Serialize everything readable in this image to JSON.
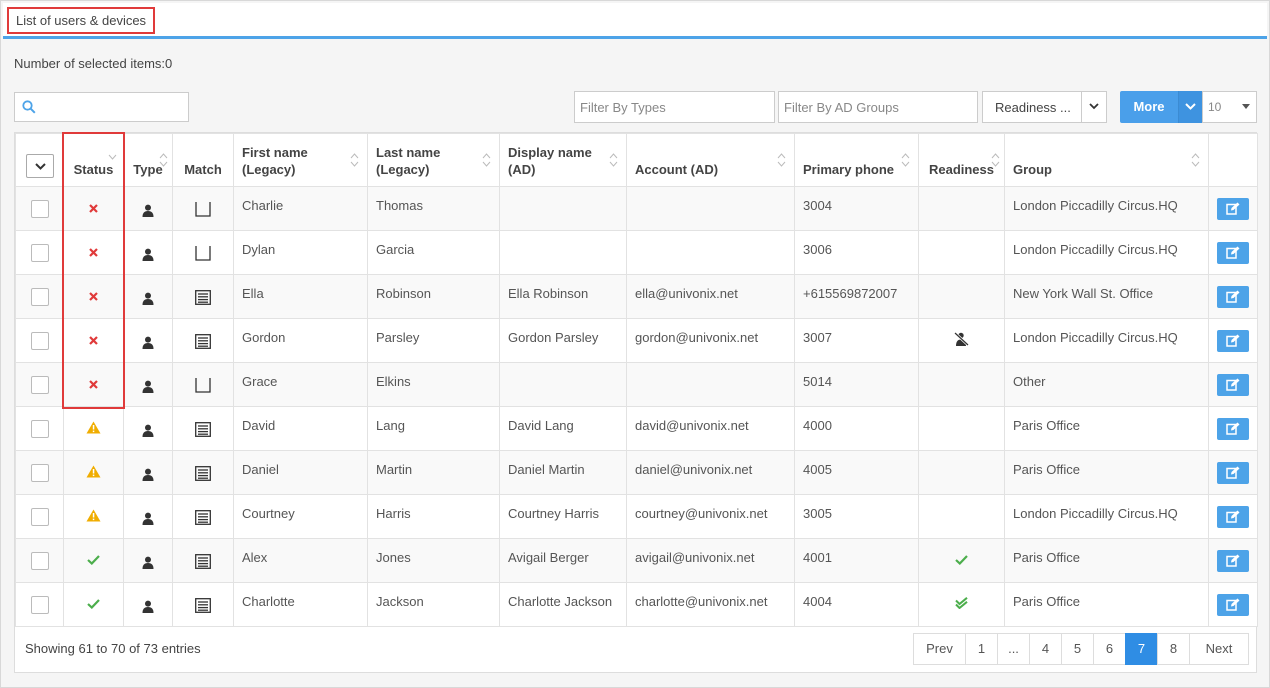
{
  "title": "List of users & devices",
  "selected_count_text": "Number of selected items:0",
  "search": {
    "placeholder": ""
  },
  "filters": {
    "types_placeholder": "Filter By Types",
    "ad_groups_placeholder": "Filter By AD Groups",
    "readiness_label": "Readiness ...",
    "more_label": "More",
    "page_size": "10"
  },
  "columns": {
    "status": "Status",
    "type": "Type",
    "match": "Match",
    "first_name_1": "First name",
    "first_name_2": "(Legacy)",
    "last_name_1": "Last name",
    "last_name_2": "(Legacy)",
    "display_name_1": "Display name",
    "display_name_2": "(AD)",
    "account": "Account (AD)",
    "phone": "Primary phone",
    "readiness": "Readiness",
    "group": "Group"
  },
  "rows": [
    {
      "status": "error",
      "type": "user-icon",
      "match": "empty-doc",
      "first": "Charlie",
      "last": "Thomas",
      "display": "",
      "account": "",
      "phone": "3004",
      "readiness": "",
      "group": "London Piccadilly Circus.HQ"
    },
    {
      "status": "error",
      "type": "user-icon",
      "match": "empty-doc",
      "first": "Dylan",
      "last": "Garcia",
      "display": "",
      "account": "",
      "phone": "3006",
      "readiness": "",
      "group": "London Piccadilly Circus.HQ"
    },
    {
      "status": "error",
      "type": "user-icon",
      "match": "lined-doc",
      "first": "Ella",
      "last": "Robinson",
      "display": "Ella Robinson",
      "account": "ella@univonix.net",
      "phone": "+615569872007",
      "readiness": "",
      "group": "New York Wall St. Office"
    },
    {
      "status": "error",
      "type": "user-icon",
      "match": "lined-doc",
      "first": "Gordon",
      "last": "Parsley",
      "display": "Gordon Parsley",
      "account": "gordon@univonix.net",
      "phone": "3007",
      "readiness": "not-ready",
      "group": "London Piccadilly Circus.HQ"
    },
    {
      "status": "error",
      "type": "user-icon",
      "match": "empty-doc",
      "first": "Grace",
      "last": "Elkins",
      "display": "",
      "account": "",
      "phone": "5014",
      "readiness": "",
      "group": "Other"
    },
    {
      "status": "warning",
      "type": "user-icon",
      "match": "lined-doc",
      "first": "David",
      "last": "Lang",
      "display": "David Lang",
      "account": "david@univonix.net",
      "phone": "4000",
      "readiness": "",
      "group": "Paris Office"
    },
    {
      "status": "warning",
      "type": "user-icon",
      "match": "lined-doc",
      "first": "Daniel",
      "last": "Martin",
      "display": "Daniel Martin",
      "account": "daniel@univonix.net",
      "phone": "4005",
      "readiness": "",
      "group": "Paris Office"
    },
    {
      "status": "warning",
      "type": "user-icon",
      "match": "lined-doc",
      "first": "Courtney",
      "last": "Harris",
      "display": "Courtney Harris",
      "account": "courtney@univonix.net",
      "phone": "3005",
      "readiness": "",
      "group": "London Piccadilly Circus.HQ"
    },
    {
      "status": "ok",
      "type": "user-icon",
      "match": "lined-doc",
      "first": "Alex",
      "last": "Jones",
      "display": "Avigail Berger",
      "account": "avigail@univonix.net",
      "phone": "4001",
      "readiness": "ready",
      "group": "Paris Office"
    },
    {
      "status": "ok",
      "type": "user-icon",
      "match": "lined-doc",
      "first": "Charlotte",
      "last": "Jackson",
      "display": "Charlotte Jackson",
      "account": "charlotte@univonix.net",
      "phone": "4004",
      "readiness": "ready-double",
      "group": "Paris Office"
    }
  ],
  "footer": {
    "info": "Showing 61 to 70 of 73 entries",
    "pages": [
      "Prev",
      "1",
      "...",
      "4",
      "5",
      "6",
      "7",
      "8",
      "Next"
    ],
    "active_page": "7"
  },
  "colors": {
    "accent": "#4da3e8",
    "error": "#e03a3a",
    "warning": "#f0ad00",
    "ok": "#4cae4c",
    "active_page": "#2f8de4"
  }
}
